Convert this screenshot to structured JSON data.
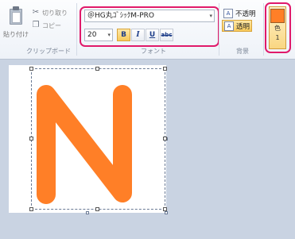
{
  "clipboard": {
    "paste_label": "貼り付け",
    "cut_label": "切り取り",
    "copy_label": "コピー",
    "group_label": "クリップボード"
  },
  "font": {
    "name_value": "＠HG丸ｺﾞｼｯｸM-PRO",
    "size_value": "20",
    "bold_label": "B",
    "italic_label": "I",
    "underline_label": "U",
    "strike_label": "abc",
    "group_label": "フォント"
  },
  "background": {
    "opaque_label": "不透明",
    "transparent_label": "透明",
    "group_label": "背景",
    "selected": "transparent"
  },
  "color": {
    "label": "色",
    "index": "1",
    "value": "#ff7f27"
  },
  "canvas": {
    "text": "N",
    "text_color": "#ff7f27"
  },
  "colors": {
    "highlight": "#e0196a",
    "ribbon_bg": "#eef2f8",
    "workspace_bg": "#c9d3e2"
  }
}
